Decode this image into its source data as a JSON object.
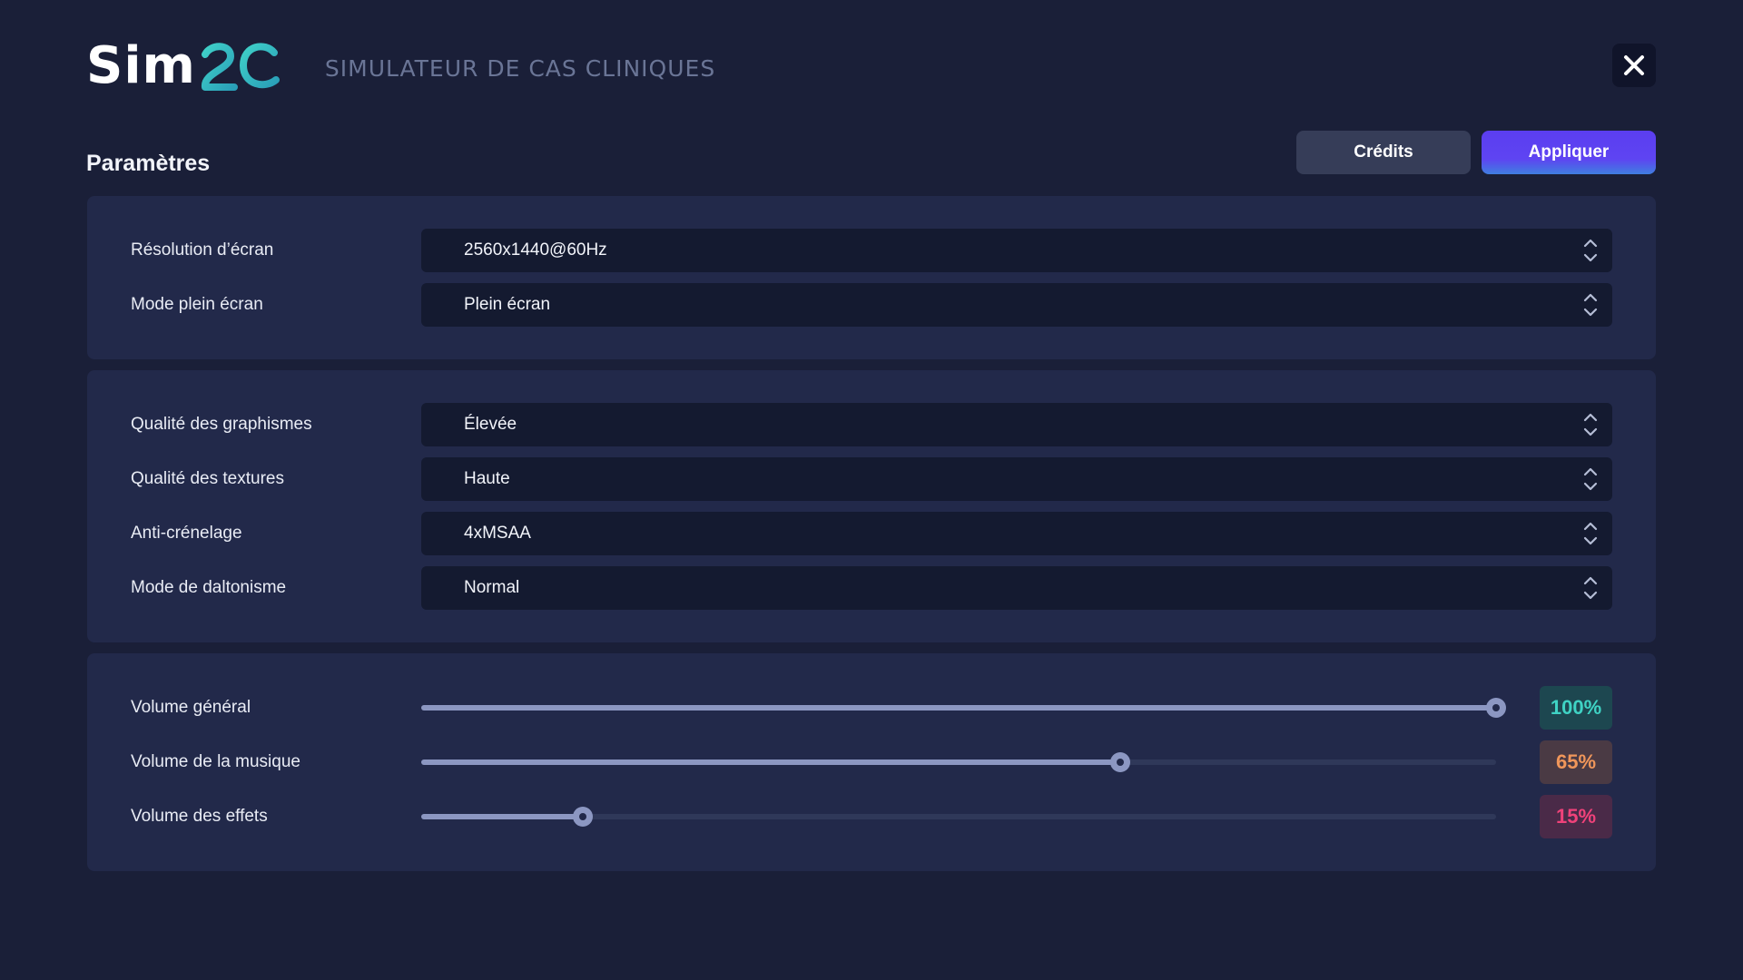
{
  "app": {
    "logo_text": "Sim2C",
    "logo_visible_text": "Sim",
    "subtitle": "SIMULATEUR DE CAS CLINIQUES"
  },
  "page": {
    "title": "Paramètres"
  },
  "buttons": {
    "credits": "Crédits",
    "apply": "Appliquer"
  },
  "icons": {
    "close": "close-icon",
    "spinner": "chevron-up-down-icon"
  },
  "display": [
    {
      "label": "Résolution d’écran",
      "value": "2560x1440@60Hz"
    },
    {
      "label": "Mode plein écran",
      "value": "Plein écran"
    }
  ],
  "graphics": [
    {
      "label": "Qualité des graphismes",
      "value": "Élevée"
    },
    {
      "label": "Qualité des textures",
      "value": "Haute"
    },
    {
      "label": "Anti-crénelage",
      "value": "4xMSAA"
    },
    {
      "label": "Mode de daltonisme",
      "value": "Normal"
    }
  ],
  "audio": [
    {
      "label": "Volume général",
      "percent": 100,
      "display": "100%",
      "color": "#3fd3c4",
      "badge_bg": "#1d4750"
    },
    {
      "label": "Volume de la musique",
      "percent": 65,
      "display": "65%",
      "color": "#f0965a",
      "badge_bg": "#4a3a44"
    },
    {
      "label": "Volume des effets",
      "percent": 15,
      "display": "15%",
      "color": "#f0427a",
      "badge_bg": "#4a2a48"
    }
  ],
  "colors": {
    "background": "#1a1f38",
    "panel": "#22294a",
    "field": "#141a30",
    "accent": "#5b3ef0",
    "logo_teal": "#3fc6c6",
    "slider": "#8c97c2"
  }
}
